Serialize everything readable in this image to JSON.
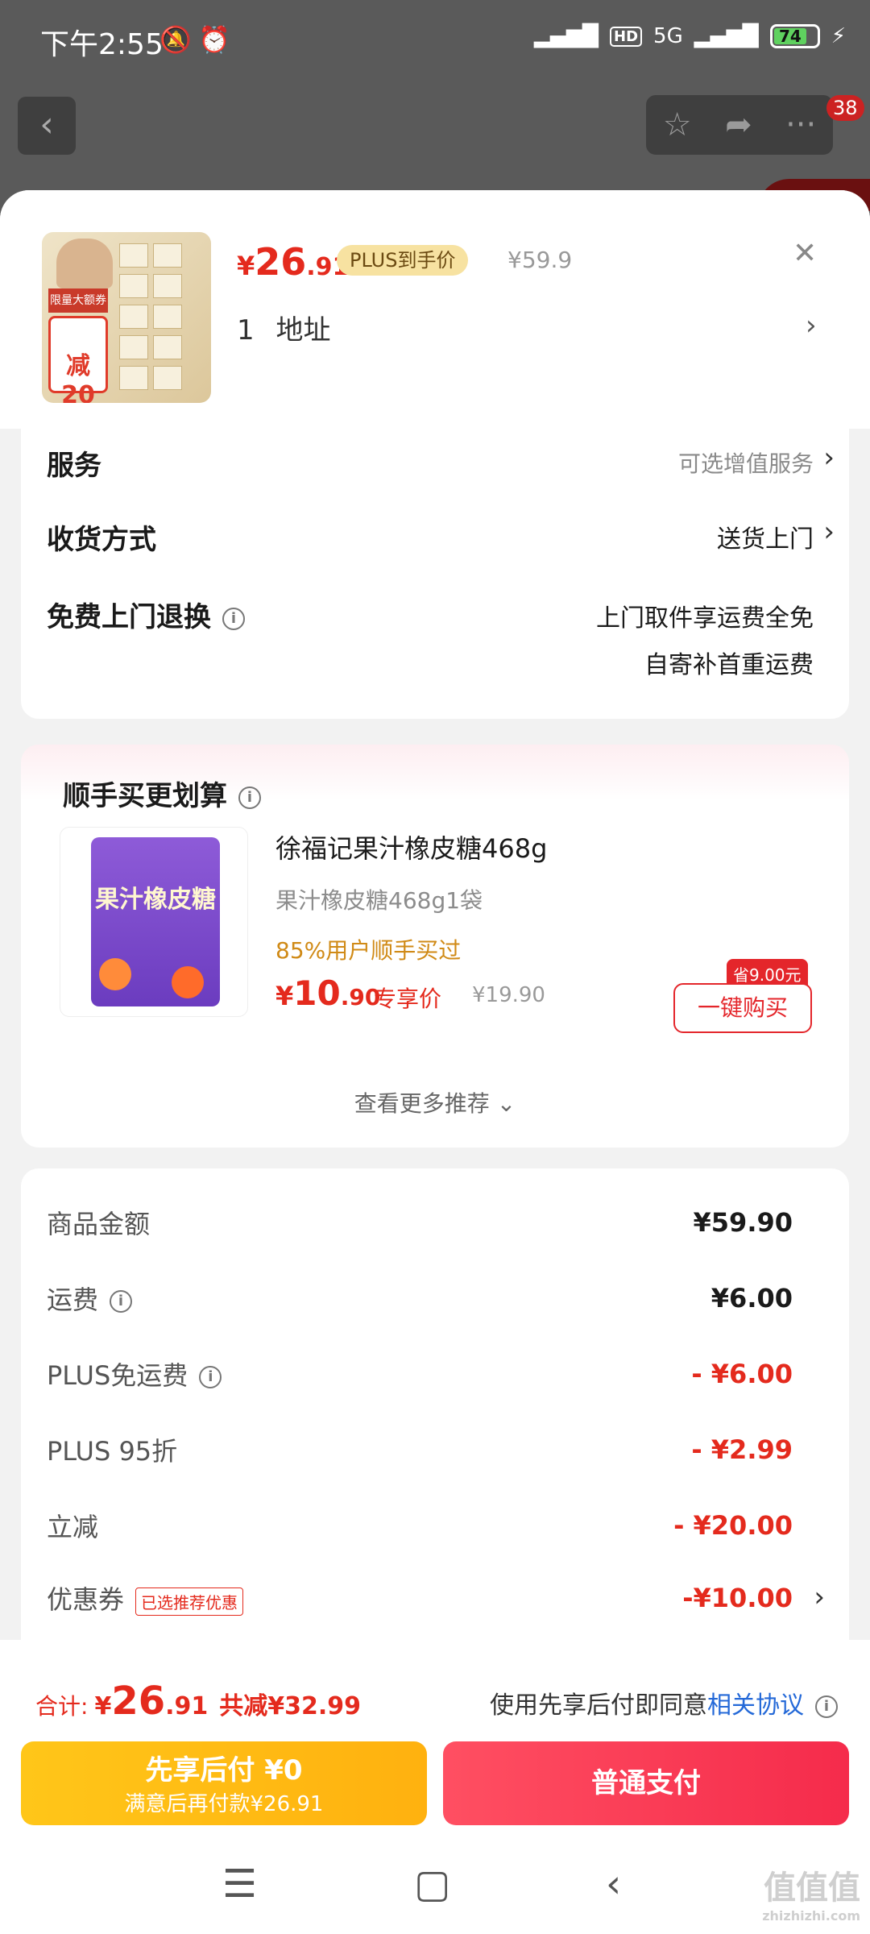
{
  "status_bar": {
    "time": "下午2:55",
    "battery": "74",
    "network": "5G",
    "hd": "HD"
  },
  "underlying_nav": {
    "badge_count": "38"
  },
  "header": {
    "price_currency": "¥",
    "price_int": "26",
    "price_dec": ".91",
    "plus_tag": "PLUS到手价",
    "original_price": "¥59.9",
    "quantity": "1",
    "address_label": "地址",
    "thumb_discount": "减20",
    "thumb_banner": "限量大额券"
  },
  "services": {
    "service_label": "服务",
    "service_value": "可选增值服务",
    "delivery_label": "收货方式",
    "delivery_value": "送货上门",
    "return_label": "免费上门退换",
    "return_value_line1": "上门取件享运费全免",
    "return_value_line2": "自寄补首重运费"
  },
  "recommend": {
    "title": "顺手买更划算",
    "product_name": "徐福记果汁橡皮糖468g",
    "product_spec": "果汁橡皮糖468g1袋",
    "buy_rate": "85%用户顺手买过",
    "price_currency": "¥",
    "price_int": "10",
    "price_dec": ".90",
    "price_label": "专享价",
    "original_price": "¥19.90",
    "save_tag": "省9.00元",
    "buy_button": "一键购买",
    "more": "查看更多推荐",
    "pack_text": "果汁橡皮糖"
  },
  "bill": {
    "rows": [
      {
        "label": "商品金额",
        "value": "¥59.90"
      },
      {
        "label": "运费",
        "value": "¥6.00"
      },
      {
        "label": "PLUS免运费",
        "value": "- ¥6.00"
      },
      {
        "label": "PLUS 95折",
        "value": "- ¥2.99"
      },
      {
        "label": "立减",
        "value": "- ¥20.00"
      },
      {
        "label": "优惠券",
        "value": "-¥10.00",
        "tag": "已选推荐优惠"
      }
    ]
  },
  "footer": {
    "total_label": "合计:",
    "total_currency": "¥",
    "total_int": "26",
    "total_dec": ".91",
    "total_saving": "共减¥32.99",
    "agree_text": "使用先享后付即同意",
    "agree_link": "相关协议",
    "later_pay_title": "先享后付 ¥0",
    "later_pay_sub": "满意后再付款¥26.91",
    "normal_pay": "普通支付"
  },
  "watermark": {
    "main": "值值值",
    "sub": "zhizhizhi.com"
  },
  "colors": {
    "accent_red": "#e42a1d",
    "pay_red": "#f52b4b",
    "later_yellow": "#ffc619",
    "link_blue": "#2469d8"
  }
}
